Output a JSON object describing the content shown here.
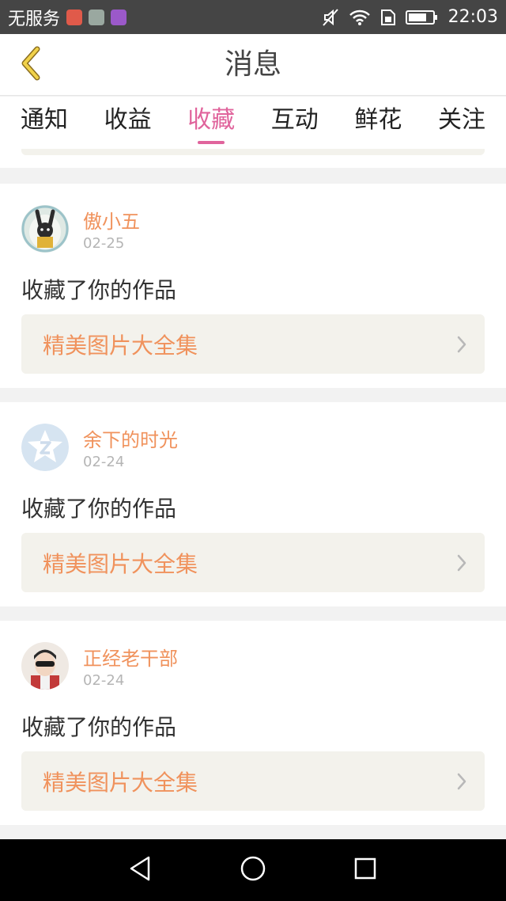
{
  "status_bar": {
    "carrier": "无服务",
    "time": "22:03",
    "icons": [
      "mail-app-icon",
      "photo-app-icon",
      "gallery-app-icon",
      "mute-icon",
      "wifi-icon",
      "sim-icon",
      "battery-icon"
    ]
  },
  "header": {
    "title": "消息",
    "back_icon": "chevron-left-icon"
  },
  "tabs": [
    {
      "label": "通知",
      "active": false
    },
    {
      "label": "收益",
      "active": false
    },
    {
      "label": "收藏",
      "active": true
    },
    {
      "label": "互动",
      "active": false
    },
    {
      "label": "鲜花",
      "active": false
    },
    {
      "label": "关注",
      "active": false
    }
  ],
  "colors": {
    "accent": "#e0649c",
    "orange": "#f0925c",
    "link_bg": "#f3f2ec"
  },
  "messages": [
    {
      "user": "傲小五",
      "date": "02-25",
      "action": "收藏了你的作品",
      "work": "精美图片大全集"
    },
    {
      "user": "余下的时光",
      "date": "02-24",
      "action": "收藏了你的作品",
      "work": "精美图片大全集"
    },
    {
      "user": "正经老干部",
      "date": "02-24",
      "action": "收藏了你的作品",
      "work": "精美图片大全集"
    }
  ],
  "nav_bar": {
    "icons": [
      "back-triangle-icon",
      "home-circle-icon",
      "recents-square-icon"
    ]
  }
}
